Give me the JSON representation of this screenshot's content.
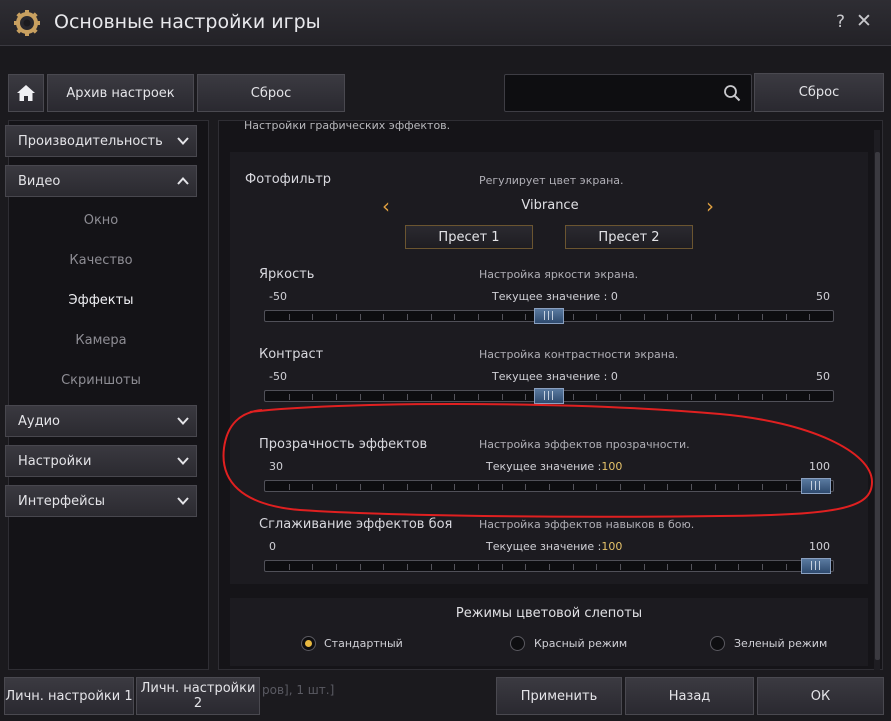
{
  "window": {
    "title": "Основные настройки игры",
    "help_label": "?",
    "close_label": "✕"
  },
  "toolbar": {
    "archive_label": "Архив настроек",
    "reset_label": "Сброс",
    "search_placeholder": "",
    "reset_right_label": "Сброс"
  },
  "sidebar": {
    "categories": [
      {
        "label": "Производительность",
        "expanded": false
      },
      {
        "label": "Видео",
        "expanded": true
      },
      {
        "label": "Аудио",
        "expanded": false
      },
      {
        "label": "Настройки",
        "expanded": false
      },
      {
        "label": "Интерфейсы",
        "expanded": false
      }
    ],
    "video_items": [
      "Окно",
      "Качество",
      "Эффекты",
      "Камера",
      "Скриншоты"
    ],
    "active_item": "Эффекты"
  },
  "main": {
    "cut_text": "Настройки графических эффектов.",
    "photofilter": {
      "label": "Фотофильтр",
      "description": "Регулирует цвет экрана.",
      "value": "Vibrance",
      "preset1": "Пресет 1",
      "preset2": "Пресет 2"
    },
    "sliders": [
      {
        "label": "Яркость",
        "description": "Настройка яркости экрана.",
        "current_prefix": "Текущее значение :",
        "current": "0",
        "min": "-50",
        "max": "50",
        "value": 0
      },
      {
        "label": "Контраст",
        "description": "Настройка контрастности экрана.",
        "current_prefix": "Текущее значение :",
        "current": "0",
        "min": "-50",
        "max": "50",
        "value": 0
      },
      {
        "label": "Прозрачность эффектов",
        "description": "Настройка эффектов прозрачности.",
        "current_prefix": "Текущее значение :",
        "current": "100",
        "min": "30",
        "max": "100",
        "value": 100
      },
      {
        "label": "Сглаживание эффектов боя",
        "description": "Настройка эффектов навыков в бою.",
        "current_prefix": "Текущее значение :",
        "current": "100",
        "min": "0",
        "max": "100",
        "value": 100
      }
    ],
    "colorblind": {
      "title": "Режимы цветовой слепоты",
      "options": [
        "Стандартный",
        "Красный режим",
        "Зеленый режим"
      ],
      "selected": "Стандартный"
    }
  },
  "footer": {
    "personal1_label": "Личн. настройки 1",
    "personal2_label": "Личн. настройки 2",
    "apply_label": "Применить",
    "back_label": "Назад",
    "ok_label": "ОК",
    "bg_text": "ров], 1 шт.]"
  },
  "colors": {
    "accent_value": "#e6c36a",
    "thumb": "#3e5e86",
    "annotation": "#e02020"
  }
}
